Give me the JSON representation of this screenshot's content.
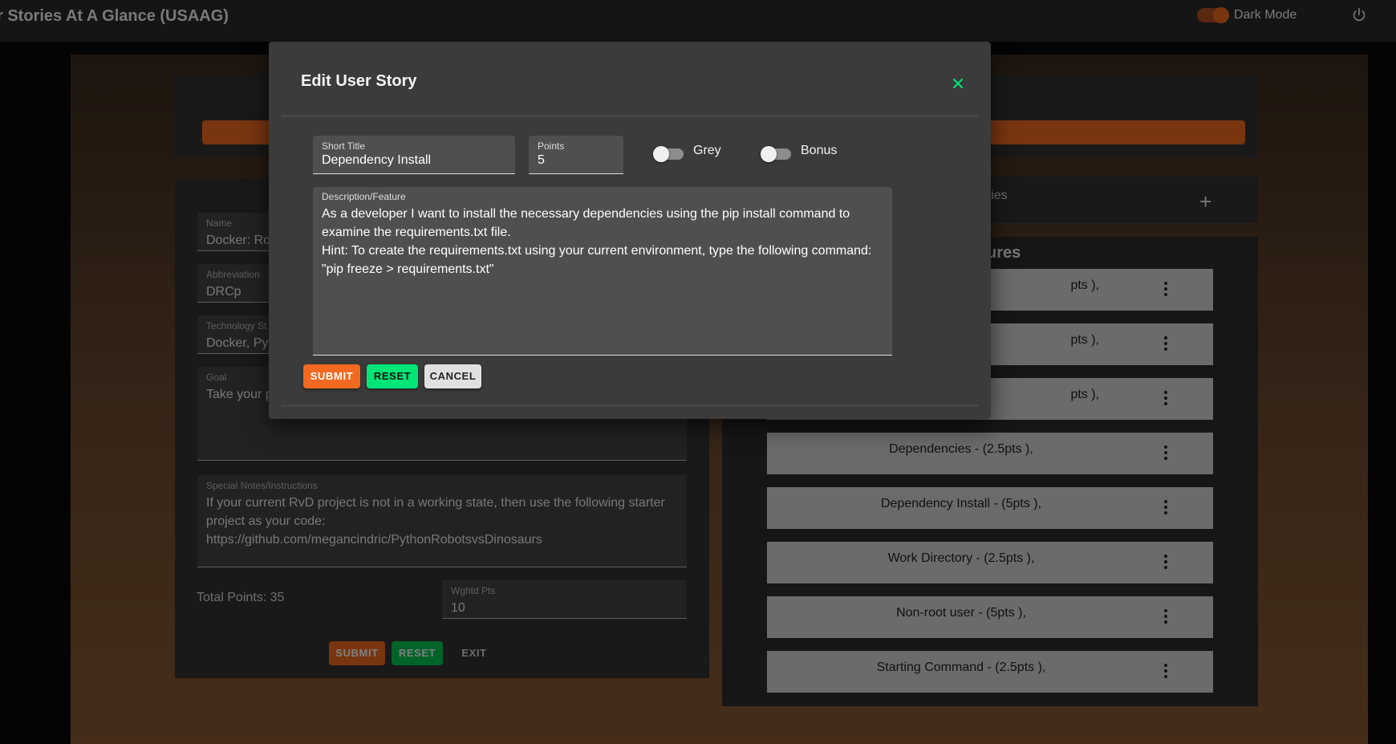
{
  "app": {
    "title": "r Stories At A Glance (USAAG)",
    "dark_mode_label": "Dark Mode"
  },
  "colors": {
    "accent_orange": "#f26a21",
    "accent_green": "#00e676",
    "modal_bg": "#3b3b3b"
  },
  "background_form": {
    "name": {
      "label": "Name",
      "value": "Docker: Ro"
    },
    "abbreviation": {
      "label": "Abbreviation",
      "value": "DRCp"
    },
    "technology": {
      "label": "Technology St",
      "value": "Docker, Pyt"
    },
    "goal": {
      "label": "Goal",
      "value": "Take your p"
    },
    "special_notes": {
      "label": "Special Notes/Instructions",
      "value": "If your current RvD project is not in a working state, then use the following starter\nproject as your code:\nhttps://github.com/megancindric/PythonRobotsvsDinosaurs"
    },
    "total_points": "Total Points: 35",
    "weighted_points": {
      "label": "Wghtd Pts",
      "value": "10"
    },
    "buttons": {
      "submit": "SUBMIT",
      "reset": "RESET",
      "exit": "EXIT"
    }
  },
  "background_list": {
    "stories_label": "ories",
    "features_label": "ures",
    "items": [
      "pts ),",
      "pts ),",
      "pts ),",
      "Dependencies - (2.5pts ),",
      "Dependency Install - (5pts ),",
      "Work Directory - (2.5pts ),",
      "Non-root user - (5pts ),",
      "Starting Command - (2.5pts ),"
    ]
  },
  "modal": {
    "title": "Edit User Story",
    "short_title": {
      "label": "Short Title",
      "value": "Dependency Install"
    },
    "points": {
      "label": "Points",
      "value": "5"
    },
    "grey_label": "Grey",
    "bonus_label": "Bonus",
    "description": {
      "label": "Description/Feature",
      "value": "As a developer I want to install the necessary dependencies using the pip install command to examine the requirements.txt file.\nHint: To create the requirements.txt using your current environment, type the following command:\n\"pip freeze > requirements.txt\""
    },
    "buttons": {
      "submit": "SUBMIT",
      "reset": "RESET",
      "cancel": "CANCEL"
    }
  }
}
